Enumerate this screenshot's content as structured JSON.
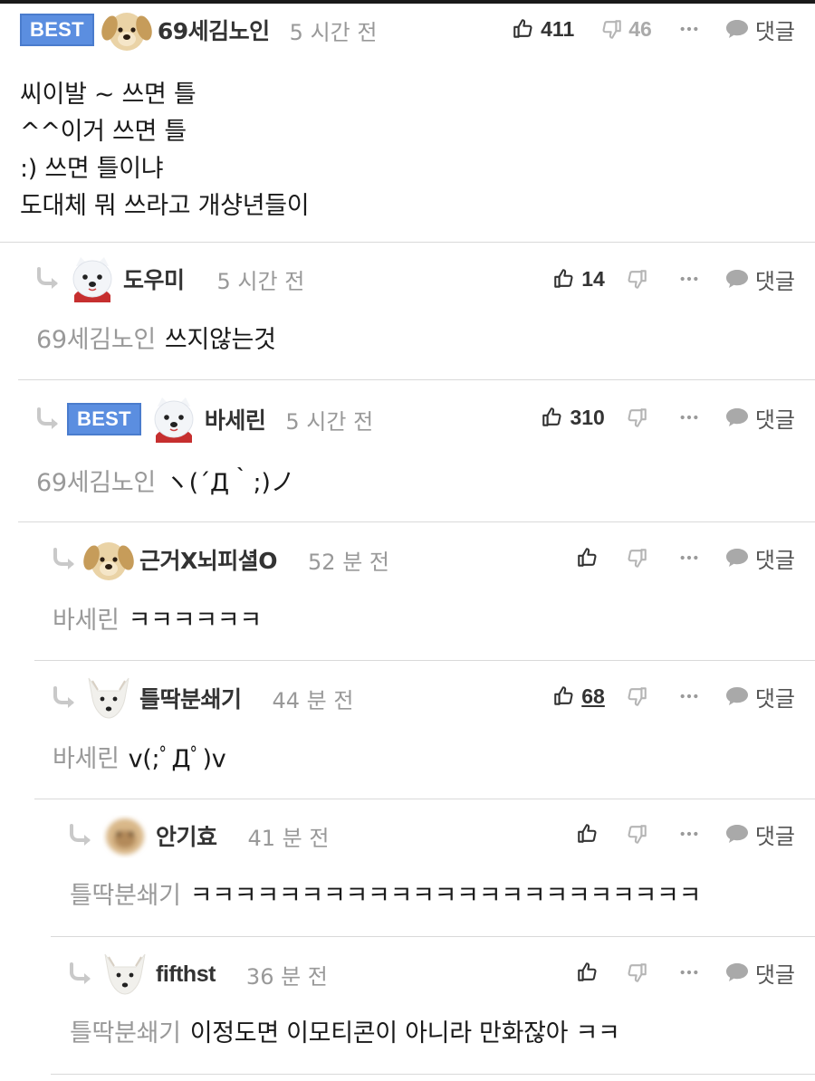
{
  "colors": {
    "best_badge": "#5b8ee0",
    "divider": "#d9d9d9",
    "muted": "#999999",
    "text": "#1a1a1a"
  },
  "icons": [
    "thumbs-up-icon",
    "thumbs-down-icon",
    "more-dots-icon",
    "speech-bubble-icon",
    "reply-arrow-icon"
  ],
  "comments": [
    {
      "best": "BEST",
      "avatar": "puppy-avatar",
      "nickname": "69세김노인",
      "time": "5 시간 전",
      "likes": "411",
      "dislikes": "46",
      "reply_label": "댓글",
      "lines": [
        "씨이발 ~ 쓰면 틀",
        "^^이거 쓰면 틀",
        ":) 쓰면 틀이냐",
        "도대체 뭐 쓰라고 개샹년들이"
      ]
    },
    {
      "avatar": "samoyed-avatar",
      "nickname": "도우미",
      "time": "5 시간 전",
      "likes": "14",
      "reply_label": "댓글",
      "mention": "69세김노인",
      "text": "쓰지않는것"
    },
    {
      "best": "BEST",
      "avatar": "samoyed-avatar",
      "nickname": "바세린",
      "time": "5 시간 전",
      "likes": "310",
      "reply_label": "댓글",
      "mention": "69세김노인",
      "text": "ヽ(´Д｀;)ノ"
    },
    {
      "avatar": "puppy-avatar",
      "nickname": "근거X뇌피셜O",
      "time": "52 분 전",
      "reply_label": "댓글",
      "mention": "바세린",
      "text": "ㅋㅋㅋㅋㅋㅋ"
    },
    {
      "avatar": "arctic-fox-avatar",
      "nickname": "틀딱분쇄기",
      "time": "44 분 전",
      "likes": "68",
      "reply_label": "댓글",
      "mention": "바세린",
      "text": "v(;ﾟДﾟ)v"
    },
    {
      "avatar": "blurred-puppy-avatar",
      "nickname": "안기효",
      "time": "41 분 전",
      "reply_label": "댓글",
      "mention": "틀딱분쇄기",
      "text": "ㅋㅋㅋㅋㅋㅋㅋㅋㅋㅋㅋㅋㅋㅋㅋㅋㅋㅋㅋㅋㅋㅋㅋ"
    },
    {
      "avatar": "arctic-fox-avatar",
      "nickname": "fifthst",
      "time": "36 분 전",
      "reply_label": "댓글",
      "mention": "틀딱분쇄기",
      "text": "이정도면 이모티콘이 아니라 만화잖아 ㅋㅋ"
    }
  ]
}
